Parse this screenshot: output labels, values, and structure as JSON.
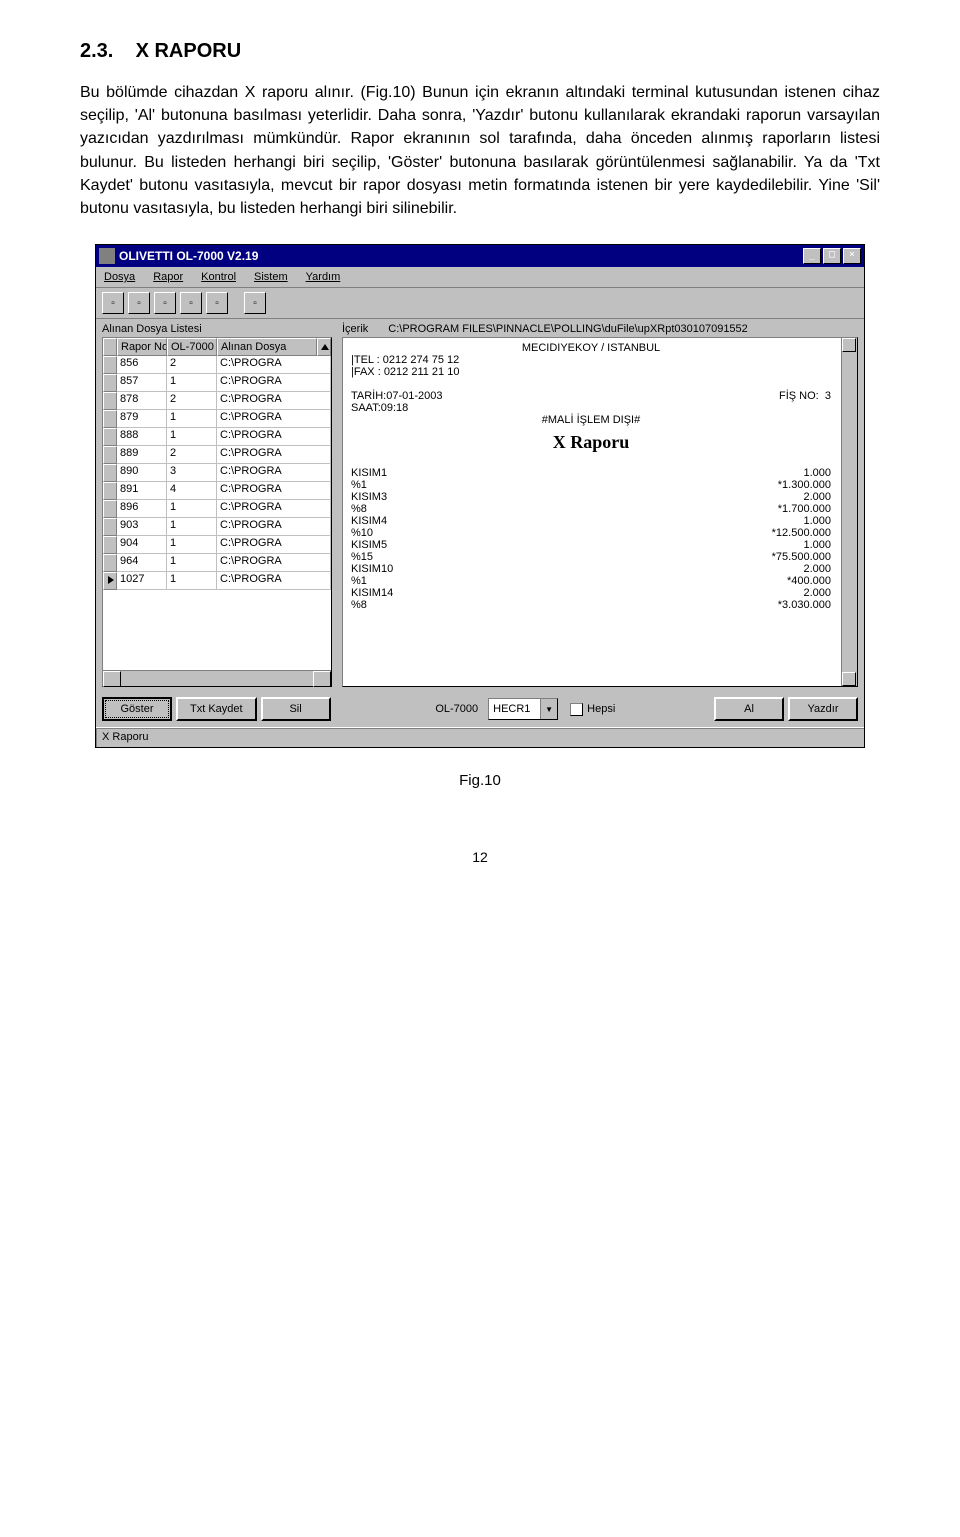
{
  "section": {
    "number": "2.3.",
    "title": "X RAPORU"
  },
  "paragraph": "Bu bölümde cihazdan X raporu alınır. (Fig.10) Bunun için ekranın altındaki terminal kutusundan istenen cihaz seçilip, 'Al' butonuna basılması yeterlidir. Daha sonra, 'Yazdır' butonu kullanılarak ekrandaki raporun varsayılan yazıcıdan yazdırılması mümkündür. Rapor ekranının sol tarafında, daha önceden alınmış raporların listesi bulunur. Bu listeden herhangi biri seçilip, 'Göster' butonuna basılarak görüntülenmesi sağlanabilir. Ya da 'Txt Kaydet' butonu vasıtasıyla, mevcut bir rapor dosyası metin formatında istenen bir yere kaydedilebilir. Yine 'Sil' butonu vasıtasıyla, bu listeden herhangi biri silinebilir.",
  "window": {
    "title": "OLIVETTI OL-7000 V2.19",
    "menus": [
      "Dosya",
      "Rapor",
      "Kontrol",
      "Sistem",
      "Yardım"
    ],
    "left_label": "Alınan Dosya Listesi",
    "grid_headers": [
      "Rapor No",
      "OL-7000",
      "Alınan Dosya"
    ],
    "grid_rows": [
      {
        "no": "856",
        "ol": "2",
        "path": "C:\\PROGRA"
      },
      {
        "no": "857",
        "ol": "1",
        "path": "C:\\PROGRA"
      },
      {
        "no": "878",
        "ol": "2",
        "path": "C:\\PROGRA"
      },
      {
        "no": "879",
        "ol": "1",
        "path": "C:\\PROGRA"
      },
      {
        "no": "888",
        "ol": "1",
        "path": "C:\\PROGRA"
      },
      {
        "no": "889",
        "ol": "2",
        "path": "C:\\PROGRA"
      },
      {
        "no": "890",
        "ol": "3",
        "path": "C:\\PROGRA"
      },
      {
        "no": "891",
        "ol": "4",
        "path": "C:\\PROGRA"
      },
      {
        "no": "896",
        "ol": "1",
        "path": "C:\\PROGRA"
      },
      {
        "no": "903",
        "ol": "1",
        "path": "C:\\PROGRA"
      },
      {
        "no": "904",
        "ol": "1",
        "path": "C:\\PROGRA"
      },
      {
        "no": "964",
        "ol": "1",
        "path": "C:\\PROGRA"
      },
      {
        "no": "1027",
        "ol": "1",
        "path": "C:\\PROGRA"
      }
    ],
    "content_label": "İçerik",
    "content_path": "C:\\PROGRAM FILES\\PINNACLE\\POLLING\\duFile\\upXRpt030107091552",
    "report": {
      "header0": "MECIDIYEKOY / ISTANBUL",
      "tel_label": "|TEL : ",
      "tel": "0212 274 75 12",
      "fax_label": "|FAX : ",
      "fax": "0212 211 21 10",
      "date_label": "TARİH:",
      "date": "07-01-2003",
      "fis_label": "FİŞ NO:",
      "fis": "3",
      "time_label": "SAAT:",
      "time": "09:18",
      "mali": "#MALİ İŞLEM DIŞI#",
      "title": "X Raporu",
      "rows": [
        {
          "l": "KISIM1",
          "r": "1.000"
        },
        {
          "l": "%1",
          "r": "*1.300.000"
        },
        {
          "l": "KISIM3",
          "r": "2.000"
        },
        {
          "l": "%8",
          "r": "*1.700.000"
        },
        {
          "l": "KISIM4",
          "r": "1.000"
        },
        {
          "l": "%10",
          "r": "*12.500.000"
        },
        {
          "l": "KISIM5",
          "r": "1.000"
        },
        {
          "l": "%15",
          "r": "*75.500.000"
        },
        {
          "l": "KISIM10",
          "r": "2.000"
        },
        {
          "l": "%1",
          "r": "*400.000"
        },
        {
          "l": "KISIM14",
          "r": "2.000"
        },
        {
          "l": "%8",
          "r": "*3.030.000"
        }
      ]
    },
    "buttons": {
      "goster": "Göster",
      "txt": "Txt Kaydet",
      "sil": "Sil",
      "device_label": "OL-7000",
      "combo": "HECR1",
      "hepsi": "Hepsi",
      "al": "Al",
      "yazdir": "Yazdır"
    },
    "status": "X Raporu"
  },
  "figure_label": "Fig.10",
  "page_number": "12"
}
